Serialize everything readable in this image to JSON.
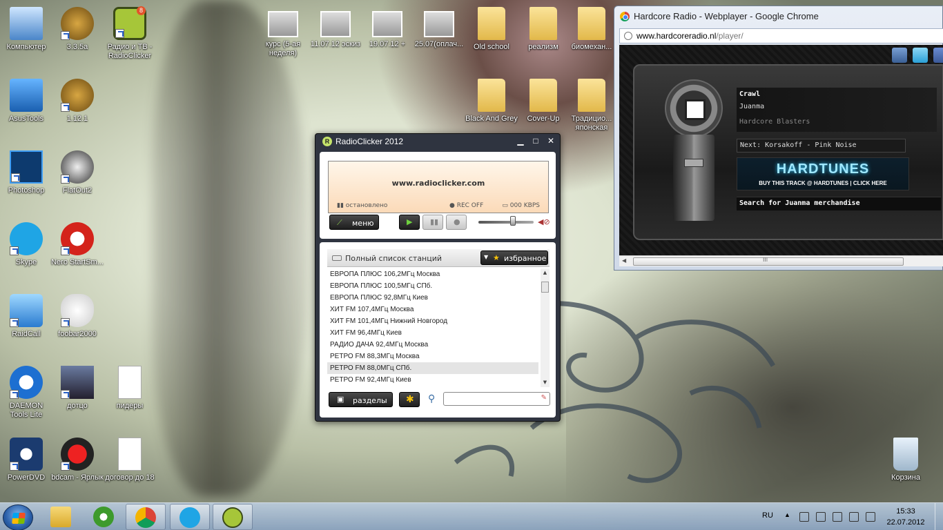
{
  "desktop": {
    "icons": [
      {
        "label": "Компьютер",
        "icon": "computer-icon"
      },
      {
        "label": "3.3.5a",
        "icon": "wow-icon"
      },
      {
        "label": "Радио и ТВ - RadioClicker",
        "icon": "radio-icon",
        "badge": "8"
      },
      {
        "label": "AsusTools",
        "icon": "asus-icon"
      },
      {
        "label": "1.12.1",
        "icon": "wow-icon"
      },
      {
        "label": "Photoshop",
        "icon": "photoshop-icon"
      },
      {
        "label": "FlatOut2",
        "icon": "flatout-icon"
      },
      {
        "label": "Skype",
        "icon": "skype-icon"
      },
      {
        "label": "Nero StartSm...",
        "icon": "nero-icon"
      },
      {
        "label": "RaidCall",
        "icon": "raidcall-icon"
      },
      {
        "label": "foobar2000",
        "icon": "foobar-icon"
      },
      {
        "label": "DAEMON Tools Lite",
        "icon": "daemon-tools-icon"
      },
      {
        "label": "дотцо",
        "icon": "game-icon"
      },
      {
        "label": "пидеры",
        "icon": "text-file-icon"
      },
      {
        "label": "PowerDVD",
        "icon": "powerdvd-icon"
      },
      {
        "label": "bdcam - Ярлык",
        "icon": "bdcam-icon"
      },
      {
        "label": "договор до 18",
        "icon": "text-file-icon"
      },
      {
        "label": "курс (5-ая неделя)",
        "icon": "image-file-icon"
      },
      {
        "label": "11.07.12 эскиз",
        "icon": "image-file-icon"
      },
      {
        "label": "19.07.12 +",
        "icon": "image-file-icon"
      },
      {
        "label": "25.07(оплач...",
        "icon": "image-file-icon"
      },
      {
        "label": "Old school",
        "icon": "folder-icon"
      },
      {
        "label": "реализм",
        "icon": "folder-icon"
      },
      {
        "label": "биомехан...",
        "icon": "folder-icon"
      },
      {
        "label": "Black And Grey",
        "icon": "folder-icon"
      },
      {
        "label": "Cover-Up",
        "icon": "folder-icon"
      },
      {
        "label": "Традицио... японская",
        "icon": "folder-icon"
      },
      {
        "label": "Корзина",
        "icon": "recycle-bin-icon"
      }
    ]
  },
  "radioclicker": {
    "title": "RadioClicker 2012",
    "controls": {
      "minimize": "▁",
      "maximize": "□",
      "close": "✕"
    },
    "display": {
      "url": "www.radioclicker.com",
      "status": "остановлено",
      "rec": "REC OFF",
      "kbps": "000 KBPS"
    },
    "menu_label": "меню",
    "volume_level": 0.6,
    "list_header": "Полный список станций",
    "favorites_label": "избранное",
    "stations": [
      "ЕВРОПА ПЛЮС 106,2МГц Москва",
      "ЕВРОПА ПЛЮС 100,5МГц СПб.",
      "ЕВРОПА ПЛЮС 92,8МГц Киев",
      "ХИТ FM 107,4МГц Москва",
      "ХИТ FM 101,4МГц Нижний Новгород",
      "ХИТ FM 96,4МГц Киев",
      "РАДИО ДАЧА 92,4МГц Москва",
      "РЕТРО FM 88,3МГц Москва",
      "РЕТРО FM 88,0МГц СПб.",
      "РЕТРО FM 92,4МГц Киев"
    ],
    "selected_station_index": 8,
    "sections_label": "разделы",
    "search_value": ""
  },
  "chrome": {
    "window_title": "Hardcore Radio - Webplayer - Google Chrome",
    "url_host": "www.hardcoreradio.nl",
    "url_path": "/player/",
    "player": {
      "track": "Crawl",
      "artist": "Juanma",
      "label": "Hardcore Blasters",
      "next": "Next: Korsakoff - Pink Noise",
      "banner_logo": "HARDTUNES",
      "banner_sub": "BUY THIS TRACK @ HARDTUNES | CLICK HERE",
      "merch": "Search for Juanma merchandise"
    }
  },
  "taskbar": {
    "apps": [
      "explorer",
      "utorrent",
      "chrome",
      "skype",
      "radioclicker"
    ],
    "language": "RU",
    "time": "15:33",
    "date": "22.07.2012"
  }
}
